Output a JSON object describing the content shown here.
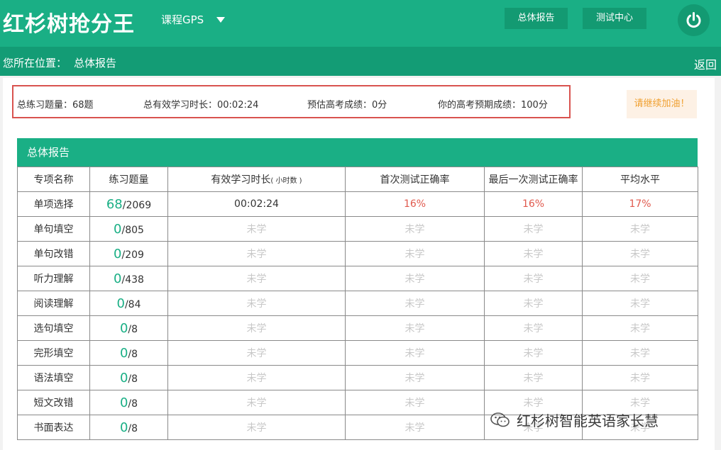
{
  "header": {
    "logo": "红杉树抢分王",
    "course_menu": "课程GPS",
    "report_button": "总体报告",
    "test_button": "测试中心"
  },
  "breadcrumb": {
    "prefix": "您所在位置：",
    "current": "总体报告",
    "back": "返回"
  },
  "summary": {
    "total_questions": "总练习题量：68题",
    "study_time": "总有效学习时长：00:02:24",
    "estimated_score": "预估高考成绩：0分",
    "expected_score": "你的高考预期成绩：100分"
  },
  "cheer_button": "请继续加油！",
  "report": {
    "title": "总体报告",
    "columns": [
      "专项名称",
      "练习题量",
      "有效学习时长",
      "首次测试正确率",
      "最后一次测试正确率",
      "平均水平"
    ],
    "time_unit": "( 小时数 )",
    "rows": [
      {
        "name": "单项选择",
        "done": "68",
        "total": "/2069",
        "time": "00:02:24",
        "first": "16%",
        "last": "16%",
        "avg": "17%",
        "active": true
      },
      {
        "name": "单句填空",
        "done": "0",
        "total": "/805",
        "time": "未学",
        "first": "未学",
        "last": "未学",
        "avg": "未学",
        "active": false
      },
      {
        "name": "单句改错",
        "done": "0",
        "total": "/209",
        "time": "未学",
        "first": "未学",
        "last": "未学",
        "avg": "未学",
        "active": false
      },
      {
        "name": "听力理解",
        "done": "0",
        "total": "/438",
        "time": "未学",
        "first": "未学",
        "last": "未学",
        "avg": "未学",
        "active": false
      },
      {
        "name": "阅读理解",
        "done": "0",
        "total": "/84",
        "time": "未学",
        "first": "未学",
        "last": "未学",
        "avg": "未学",
        "active": false
      },
      {
        "name": "选句填空",
        "done": "0",
        "total": "/8",
        "time": "未学",
        "first": "未学",
        "last": "未学",
        "avg": "未学",
        "active": false
      },
      {
        "name": "完形填空",
        "done": "0",
        "total": "/8",
        "time": "未学",
        "first": "未学",
        "last": "未学",
        "avg": "未学",
        "active": false
      },
      {
        "name": "语法填空",
        "done": "0",
        "total": "/8",
        "time": "未学",
        "first": "未学",
        "last": "未学",
        "avg": "未学",
        "active": false
      },
      {
        "name": "短文改错",
        "done": "0",
        "total": "/8",
        "time": "未学",
        "first": "未学",
        "last": "未学",
        "avg": "未学",
        "active": false
      },
      {
        "name": "书面表达",
        "done": "0",
        "total": "/8",
        "time": "未学",
        "first": "未学",
        "last": "未学",
        "avg": "未学",
        "active": false
      }
    ]
  },
  "watermark": "红杉树智能英语家长慧",
  "colors": {
    "primary": "#1aaf85",
    "primary_dark": "#139c75",
    "highlight_border": "#d9534f",
    "rate_red": "#e05a4e",
    "not_learned": "#c8c8c8",
    "cheer_text": "#f0a030"
  },
  "icons": {
    "power": "power-icon",
    "dropdown": "caret-down-icon",
    "watermark": "wechat-icon"
  }
}
